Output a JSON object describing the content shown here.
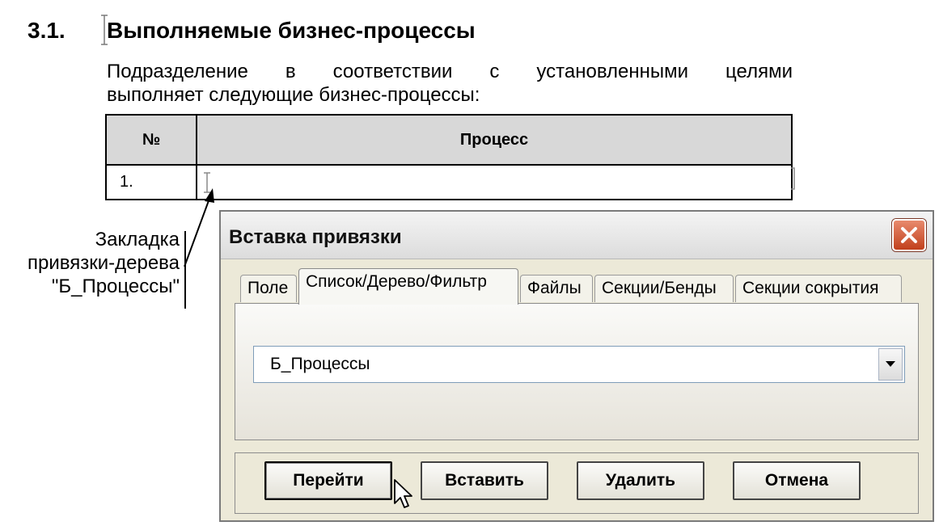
{
  "document": {
    "heading_number": "3.1.",
    "heading_title": "Выполняемые бизнес-процессы",
    "intro_line1": "Подразделение в соответствии с установленными целями",
    "intro_line2": "выполняет следующие бизнес-процессы:",
    "table": {
      "headers": [
        "№",
        "Процесс"
      ],
      "rows": [
        [
          "1.",
          ""
        ]
      ]
    },
    "callout": {
      "line1": "Закладка",
      "line2": "привязки-дерева",
      "line3": "\"Б_Процессы\""
    }
  },
  "dialog": {
    "title": "Вставка привязки",
    "tabs": [
      {
        "label": "Поле",
        "active": false
      },
      {
        "label": "Список/Дерево/Фильтр",
        "active": true
      },
      {
        "label": "Файлы",
        "active": false
      },
      {
        "label": "Секции/Бенды",
        "active": false
      },
      {
        "label": "Секции сокрытия",
        "active": false
      }
    ],
    "select": {
      "value": "Б_Процессы"
    },
    "buttons": {
      "go": "Перейти",
      "insert": "Вставить",
      "delete": "Удалить",
      "cancel": "Отмена"
    },
    "colors": {
      "close_button": "#d0552f",
      "dialog_bg": "#ece9d8",
      "header_fill": "#d8d8d8"
    }
  }
}
